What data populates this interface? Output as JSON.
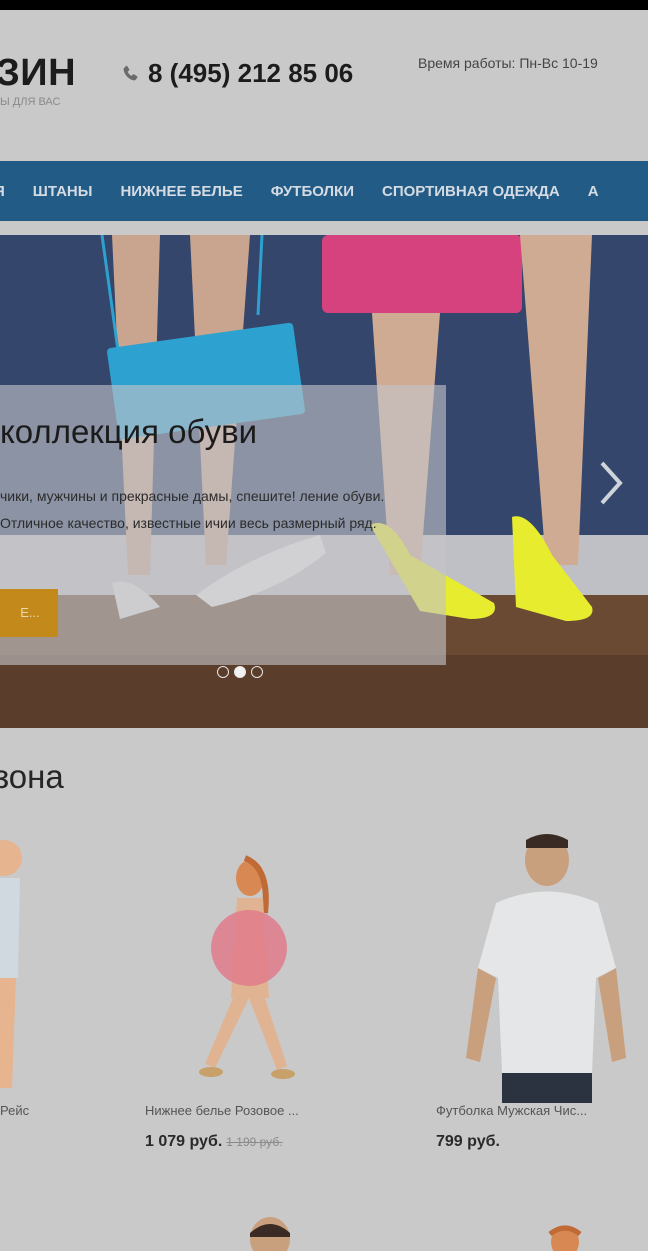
{
  "header": {
    "logo": "ЗИН",
    "tagline": "Ы ДЛЯ ВАС",
    "phone": "8 (495) 212 85 06",
    "hours": "Время работы: Пн-Вс 10-19"
  },
  "nav": {
    "items": [
      "Я",
      "ШТАНЫ",
      "НИЖНЕЕ БЕЛЬЕ",
      "ФУТБОЛКИ",
      "СПОРТИВНАЯ ОДЕЖДА",
      "А"
    ]
  },
  "hero": {
    "title": "коллекция обуви",
    "text": "чики, мужчины и прекрасные дамы, спешите! ление обуви. Отличное качество, известные ичии весь размерный ряд.",
    "button": "Е...",
    "slides": 3,
    "active_slide": 2
  },
  "section": {
    "title": "зона"
  },
  "products": [
    {
      "name": "Рейс",
      "price": "",
      "old_price": ""
    },
    {
      "name": "Нижнее белье Розовое ...",
      "price": "1 079 руб.",
      "old_price": "1 199 руб."
    },
    {
      "name": "Футболка Мужская Чис...",
      "price": "799 руб.",
      "old_price": ""
    }
  ],
  "colors": {
    "nav_bg": "#235b87",
    "button": "#c38a1b",
    "page_bg": "#c9c9c9"
  },
  "icons": {
    "phone": "phone-icon",
    "arrow": "chevron-right-icon"
  }
}
